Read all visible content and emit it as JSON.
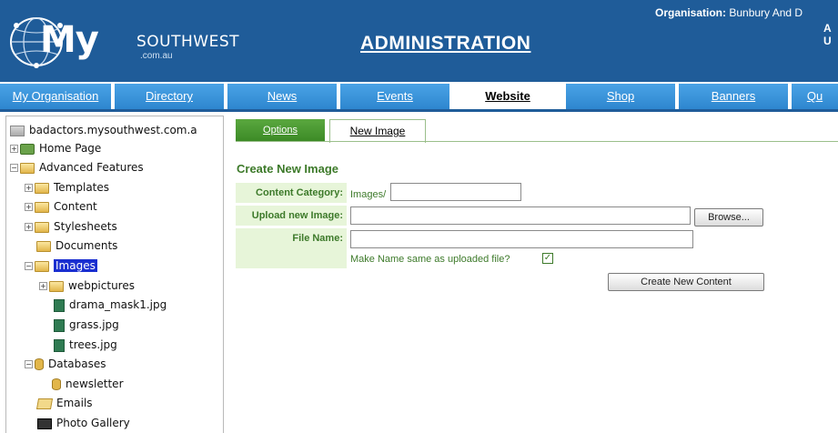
{
  "header": {
    "logo_main": "My",
    "logo_region": "SOUTHWEST",
    "logo_domain": ".com.au",
    "title": "ADMINISTRATION",
    "organisation_label": "Organisation:",
    "organisation_value": "Bunbury And D",
    "info_line_a": "A",
    "info_line_b": "U"
  },
  "nav": {
    "tabs": [
      {
        "label": "My Organisation"
      },
      {
        "label": "Directory"
      },
      {
        "label": "News"
      },
      {
        "label": "Events"
      },
      {
        "label": "Website"
      },
      {
        "label": "Shop"
      },
      {
        "label": "Banners"
      },
      {
        "label": "Qu"
      }
    ],
    "active_tab": "Website"
  },
  "sidebar": {
    "tree": [
      {
        "label": "badactors.mysouthwest.com.a"
      },
      {
        "label": "Home Page"
      },
      {
        "label": "Advanced Features"
      },
      {
        "label": "Templates"
      },
      {
        "label": "Content"
      },
      {
        "label": "Stylesheets"
      },
      {
        "label": "Documents"
      },
      {
        "label": "Images"
      },
      {
        "label": "webpictures"
      },
      {
        "label": "drama_mask1.jpg"
      },
      {
        "label": "grass.jpg"
      },
      {
        "label": "trees.jpg"
      },
      {
        "label": "Databases"
      },
      {
        "label": "newsletter"
      },
      {
        "label": "Emails"
      },
      {
        "label": "Photo Gallery"
      }
    ],
    "selected": "Images"
  },
  "tabs": {
    "options_label": "Options",
    "new_image_label": "New Image"
  },
  "form": {
    "title": "Create New Image",
    "content_category_label": "Content Category:",
    "content_category_prefix": "Images/",
    "content_category_value": "",
    "upload_label": "Upload new Image:",
    "upload_value": "",
    "browse_label": "Browse...",
    "file_name_label": "File Name:",
    "file_name_value": "",
    "checkbox_label": "Make Name same as uploaded file?",
    "checkbox_checked": true,
    "checkbox_mark": "✓",
    "submit_label": "Create New Content"
  },
  "colors": {
    "header_bg": "#1f5c99",
    "nav_tab_bg": "#3a93d9",
    "accent_green": "#3d7a2a",
    "label_bg": "#e7f5d9",
    "selection": "#1a2fd0"
  },
  "icons": {
    "folder": "folder-icon",
    "file": "image-file-icon",
    "database": "database-icon",
    "home": "home-page-icon",
    "email": "email-icon",
    "photo": "photo-gallery-icon",
    "expand": "plus-expand-icon",
    "collapse": "minus-collapse-icon"
  }
}
